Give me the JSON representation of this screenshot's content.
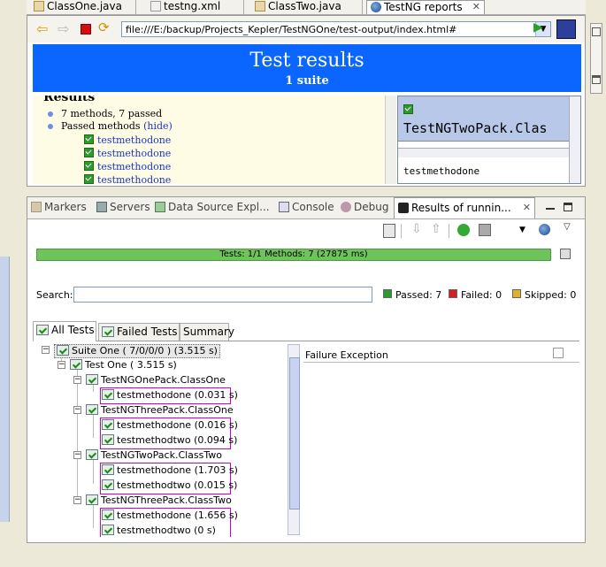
{
  "editor_tabs": [
    {
      "label": "ClassOne.java"
    },
    {
      "label": "testng.xml"
    },
    {
      "label": "ClassTwo.java"
    },
    {
      "label": "TestNG reports",
      "active": true
    }
  ],
  "browser": {
    "url": "file:///E:/backup/Projects_Kepler/TestNGOne/test-output/index.html#",
    "banner_title": "Test results",
    "banner_subtitle": "1 suite",
    "results_heading": "Results",
    "summary": "7 methods, 7 passed",
    "passed_label": "Passed methods",
    "hide_link": "(hide)",
    "passed_methods": [
      "testmethodone",
      "testmethodone",
      "testmethodone",
      "testmethodone"
    ],
    "right_pack": "TestNGTwoPack.Clas",
    "right_method": "testmethodone"
  },
  "view_tabs": [
    {
      "label": "Markers"
    },
    {
      "label": "Servers"
    },
    {
      "label": "Data Source Expl..."
    },
    {
      "label": "Console"
    },
    {
      "label": "Debug"
    },
    {
      "label": "Results of runnin...",
      "active": true
    }
  ],
  "progress": {
    "text": "Tests: 1/1  Methods: 7 (27875 ms)",
    "fraction": 1.0,
    "color": "#6ec45b"
  },
  "search": {
    "label": "Search:",
    "value": ""
  },
  "stats": {
    "passed": "Passed: 7",
    "failed": "Failed: 0",
    "skipped": "Skipped: 0"
  },
  "inner_tabs": [
    {
      "label": "All Tests",
      "active": true
    },
    {
      "label": "Failed Tests"
    },
    {
      "label": "Summary"
    }
  ],
  "tree": {
    "suite": "Suite One ( 7/0/0/0 ) (3.515 s)",
    "test": "Test One ( 3.515 s)",
    "classes": [
      {
        "name": "TestNGOnePack.ClassOne",
        "methods": [
          "testmethodone  (0.031 s)"
        ]
      },
      {
        "name": "TestNGThreePack.ClassOne",
        "methods": [
          "testmethodone  (0.016 s)",
          "testmethodtwo  (0.094 s)"
        ]
      },
      {
        "name": "TestNGTwoPack.ClassTwo",
        "methods": [
          "testmethodone  (1.703 s)",
          "testmethodtwo  (0.015 s)"
        ]
      },
      {
        "name": "TestNGThreePack.ClassTwo",
        "methods": [
          "testmethodone  (1.656 s)",
          "testmethodtwo  (0 s)"
        ]
      }
    ]
  },
  "failure": {
    "label": "Failure Exception"
  }
}
